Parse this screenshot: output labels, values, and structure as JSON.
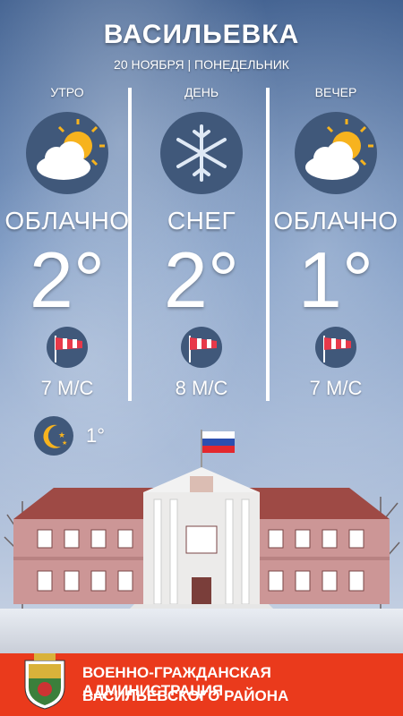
{
  "header": {
    "city": "ВАСИЛЬЕВКА",
    "date": "20 НОЯБРЯ | ПОНЕДЕЛЬНИК"
  },
  "periods": [
    {
      "name": "УТРО",
      "condition": "ОБЛАЧНО",
      "temp": "2°",
      "wind": "7 М/С",
      "icon": "partly-cloudy-icon"
    },
    {
      "name": "ДЕНЬ",
      "condition": "СНЕГ",
      "temp": "2°",
      "wind": "8 М/С",
      "icon": "snowflake-icon"
    },
    {
      "name": "ВЕЧЕР",
      "condition": "ОБЛАЧНО",
      "temp": "1°",
      "wind": "7 М/С",
      "icon": "partly-cloudy-icon"
    }
  ],
  "night": {
    "temp": "1°",
    "icon": "moon-stars-icon"
  },
  "footer": {
    "line1": "ВОЕННО-ГРАЖДАНСКАЯ АДМИНИСТРАЦИЯ",
    "line2": "ВАСИЛЬЕВСКОГО РАЙОНА"
  },
  "colors": {
    "footer_bg": "#ea3a1c",
    "icon_bg": "#40587a",
    "sun": "#f7b31e",
    "windsock": "#e8394a"
  }
}
